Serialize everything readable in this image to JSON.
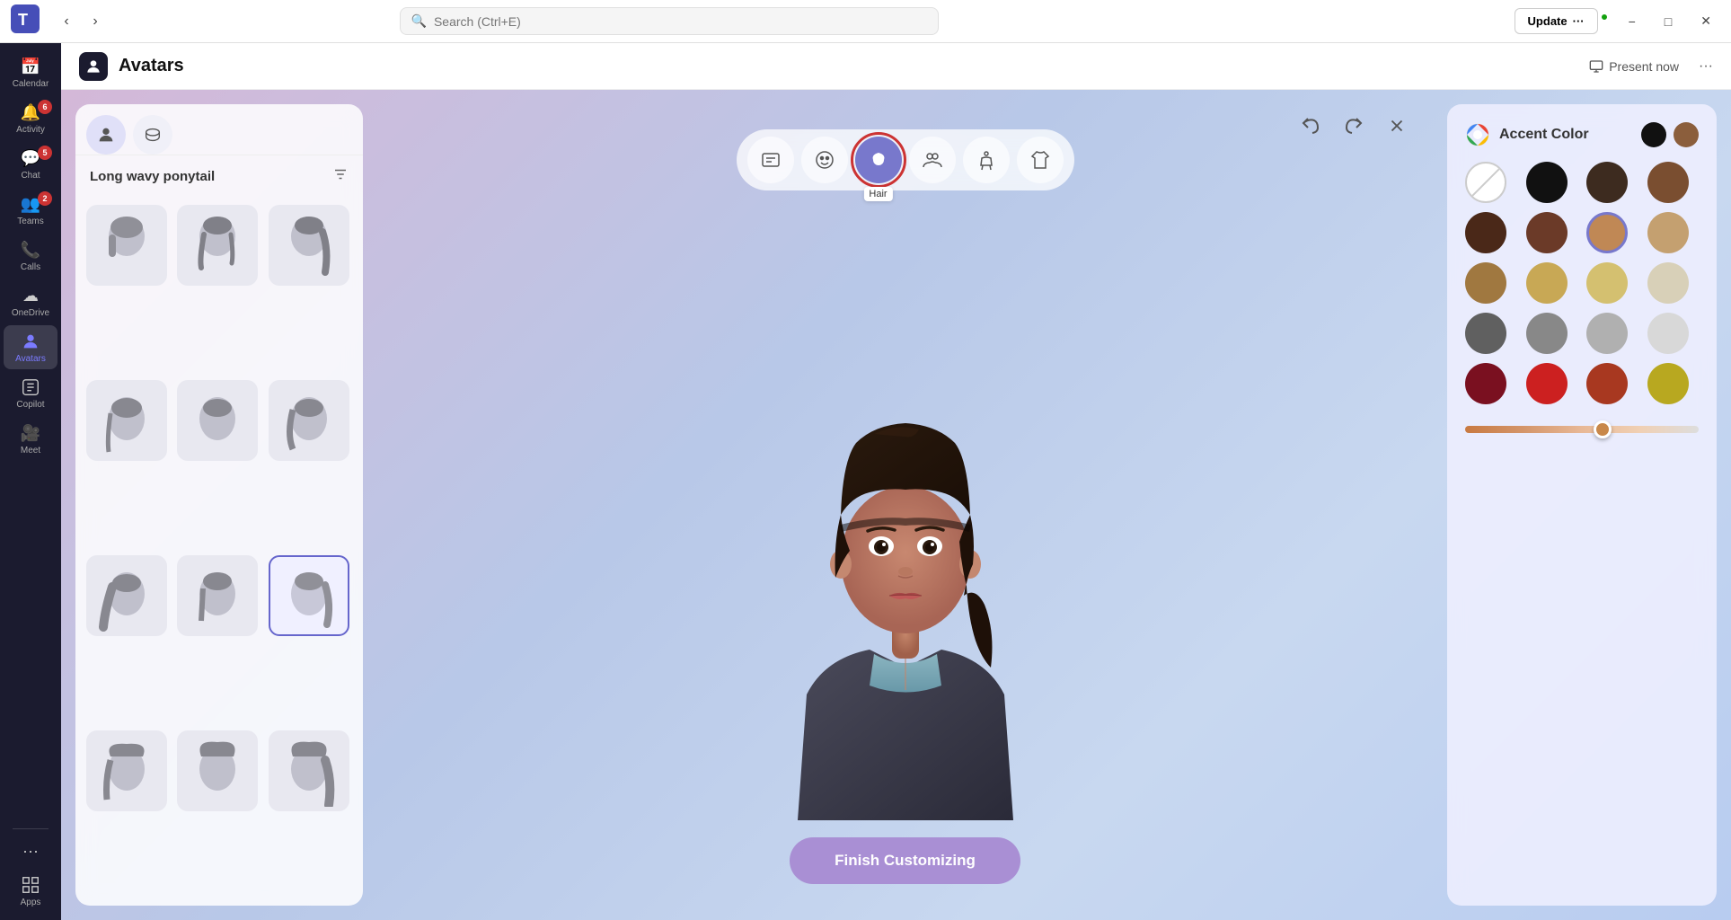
{
  "titlebar": {
    "app_logo": "Teams logo",
    "search_placeholder": "Search (Ctrl+E)",
    "update_label": "Update",
    "update_dots": "···",
    "minimize": "−",
    "maximize": "□",
    "close": "✕"
  },
  "sidebar": {
    "items": [
      {
        "id": "calendar",
        "label": "Calendar",
        "icon": "📅",
        "badge": null,
        "active": false
      },
      {
        "id": "activity",
        "label": "Activity",
        "icon": "🔔",
        "badge": "6",
        "active": false
      },
      {
        "id": "chat",
        "label": "Chat",
        "icon": "💬",
        "badge": "5",
        "active": false
      },
      {
        "id": "teams",
        "label": "Teams",
        "icon": "👥",
        "badge": "2",
        "active": false
      },
      {
        "id": "calls",
        "label": "Calls",
        "icon": "📞",
        "badge": null,
        "active": false
      },
      {
        "id": "onedrive",
        "label": "OneDrive",
        "icon": "☁",
        "badge": null,
        "active": false
      },
      {
        "id": "avatars",
        "label": "Avatars",
        "icon": "👤",
        "badge": null,
        "active": true
      },
      {
        "id": "copilot",
        "label": "Copilot",
        "icon": "✦",
        "badge": null,
        "active": false
      },
      {
        "id": "meet",
        "label": "Meet",
        "icon": "🎥",
        "badge": null,
        "active": false
      },
      {
        "id": "more",
        "label": "···",
        "icon": "···",
        "badge": null,
        "active": false
      },
      {
        "id": "apps",
        "label": "Apps",
        "icon": "⊞",
        "badge": null,
        "active": false
      }
    ]
  },
  "header": {
    "app_icon": "🧊",
    "title": "Avatars",
    "present_now": "Present now",
    "more_icon": "···"
  },
  "categories": [
    {
      "id": "reactions",
      "icon": "💬",
      "label": "",
      "active": false,
      "selected": false
    },
    {
      "id": "face",
      "icon": "😊",
      "label": "",
      "active": false,
      "selected": false
    },
    {
      "id": "hair",
      "icon": "👤",
      "label": "Hair",
      "active": true,
      "selected": true
    },
    {
      "id": "groups",
      "icon": "👥",
      "label": "",
      "active": false,
      "selected": false
    },
    {
      "id": "body",
      "icon": "🏃",
      "label": "",
      "active": false,
      "selected": false
    },
    {
      "id": "outfit",
      "icon": "👕",
      "label": "",
      "active": false,
      "selected": false
    }
  ],
  "hair_panel": {
    "title": "Long wavy ponytail",
    "tabs": [
      {
        "id": "hair-on",
        "icon": "👤",
        "active": true
      },
      {
        "id": "hair-off",
        "icon": "🧢",
        "active": false
      }
    ],
    "styles": [
      {
        "id": 1,
        "selected": false
      },
      {
        "id": 2,
        "selected": false
      },
      {
        "id": 3,
        "selected": false
      },
      {
        "id": 4,
        "selected": false
      },
      {
        "id": 5,
        "selected": false
      },
      {
        "id": 6,
        "selected": false
      },
      {
        "id": 7,
        "selected": false
      },
      {
        "id": 8,
        "selected": false
      },
      {
        "id": 9,
        "selected": true
      },
      {
        "id": 10,
        "selected": false
      },
      {
        "id": 11,
        "selected": false
      },
      {
        "id": 12,
        "selected": false
      }
    ]
  },
  "color_panel": {
    "accent_color_label": "Accent Color",
    "accent_swatches": [
      {
        "color": "#111111"
      },
      {
        "color": "#8b5e3c"
      }
    ],
    "colors": [
      {
        "id": "none",
        "color": "none",
        "selected": false
      },
      {
        "id": "black",
        "color": "#111111",
        "selected": false
      },
      {
        "id": "darkbrown",
        "color": "#3d2b1f",
        "selected": false
      },
      {
        "id": "mediumbrown",
        "color": "#7a4e30",
        "selected": false
      },
      {
        "id": "darkchoc",
        "color": "#4a2818",
        "selected": false
      },
      {
        "id": "chocbrown",
        "color": "#6b3a28",
        "selected": false
      },
      {
        "id": "warmtan",
        "color": "#c08855",
        "selected": true
      },
      {
        "id": "sandybrown",
        "color": "#c4a070",
        "selected": false
      },
      {
        "id": "goldenbrown",
        "color": "#a07840",
        "selected": false
      },
      {
        "id": "lightgold",
        "color": "#c8a855",
        "selected": false
      },
      {
        "id": "warmblonde",
        "color": "#d4c070",
        "selected": false
      },
      {
        "id": "platblonde",
        "color": "#d8d0b8",
        "selected": false
      },
      {
        "id": "darkgray",
        "color": "#606060",
        "selected": false
      },
      {
        "id": "medgray",
        "color": "#888888",
        "selected": false
      },
      {
        "id": "lightgray",
        "color": "#b0b0b0",
        "selected": false
      },
      {
        "id": "white",
        "color": "#d8d8d8",
        "selected": false
      },
      {
        "id": "darkred",
        "color": "#7a1020",
        "selected": false
      },
      {
        "id": "brightred",
        "color": "#cc2020",
        "selected": false
      },
      {
        "id": "auburn",
        "color": "#a83820",
        "selected": false
      },
      {
        "id": "dirtygold",
        "color": "#b8a820",
        "selected": false
      }
    ],
    "slider_value": 55
  },
  "editor_controls": {
    "undo_label": "↩",
    "redo_label": "↪",
    "close_label": "✕"
  },
  "finish_button": {
    "label": "Finish Customizing"
  }
}
